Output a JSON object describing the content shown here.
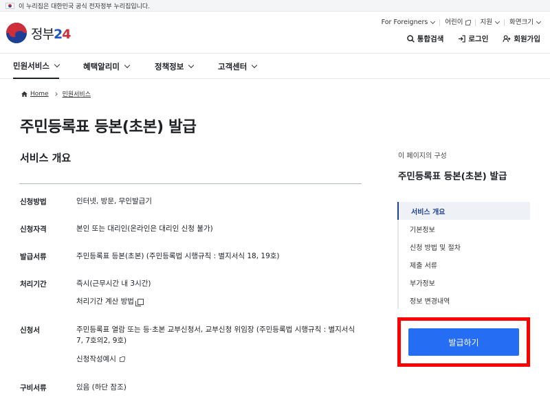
{
  "gov_banner": {
    "text": "이 누리집은 대한민국 공식 전자정부 누리집입니다."
  },
  "logo": {
    "text": "정부",
    "num_2": "2",
    "num_4": "4"
  },
  "util_links": [
    {
      "label": "For Foreigners"
    },
    {
      "label": "어린이"
    },
    {
      "label": "지원"
    },
    {
      "label": "화면크기"
    }
  ],
  "auth": {
    "search": "통합검색",
    "login": "로그인",
    "join": "회원가입"
  },
  "gnb": [
    {
      "label": "민원서비스"
    },
    {
      "label": "혜택알리미"
    },
    {
      "label": "정책정보"
    },
    {
      "label": "고객센터"
    }
  ],
  "breadcrumb": {
    "home": "Home",
    "current": "민원서비스"
  },
  "page_title": "주민등록표 등본(초본) 발급",
  "section_title": "서비스 개요",
  "rows": [
    {
      "label": "신청방법",
      "value": "인터넷, 방문, 무인발급기"
    },
    {
      "label": "신청자격",
      "value": "본인 또는 대리인(온라인은 대리인 신청 불가)"
    },
    {
      "label": "발급서류",
      "value": "주민등록표 등본(초본) (주민등록법 시행규칙 : 별지서식 18, 19호)"
    },
    {
      "label": "처리기간",
      "value": "즉시(근무시간 내 3시간)",
      "link": "처리기간 계산 방법"
    },
    {
      "label": "신청서",
      "value": "주민등록표 열람 또는 등·초본 교부신청서, 교부신청 위임장 (주민등록법 시행규칙 : 별지서식 7, 7호의2, 9호)",
      "link": "신청작성예시"
    },
    {
      "label": "구비서류",
      "value": "있음 (하단 참조)"
    }
  ],
  "toc": {
    "heading": "이 페이지의 구성",
    "title": "주민등록표 등본(초본) 발급",
    "items": [
      "서비스 개요",
      "기본정보",
      "신청 방법 및 절차",
      "제출 서류",
      "부가정보",
      "정보 변경내역"
    ]
  },
  "issue_button": "발급하기",
  "colors": {
    "primary": "#256ef4",
    "highlight": "#ff0000",
    "toc_active": "#1d3f8c"
  }
}
